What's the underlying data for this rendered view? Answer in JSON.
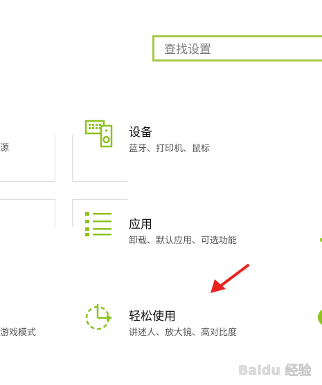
{
  "search": {
    "placeholder": "查找设置"
  },
  "left_edge": {
    "item_a_desc": "源",
    "item_c_desc": "游戏模式"
  },
  "items": [
    {
      "title": "设备",
      "desc": "蓝牙、打印机、鼠标",
      "icon": "devices-icon"
    },
    {
      "title": "应用",
      "desc": "卸载、默认应用、可选功能",
      "icon": "apps-list-icon"
    },
    {
      "title": "轻松使用",
      "desc": "讲述人、放大镜、高对比度",
      "icon": "ease-of-access-icon"
    }
  ],
  "watermark": {
    "text": "Baidu 经验"
  },
  "colors": {
    "accent": "#8dc21f",
    "search_border": "#a6c94a",
    "arrow": "#e8231f"
  }
}
